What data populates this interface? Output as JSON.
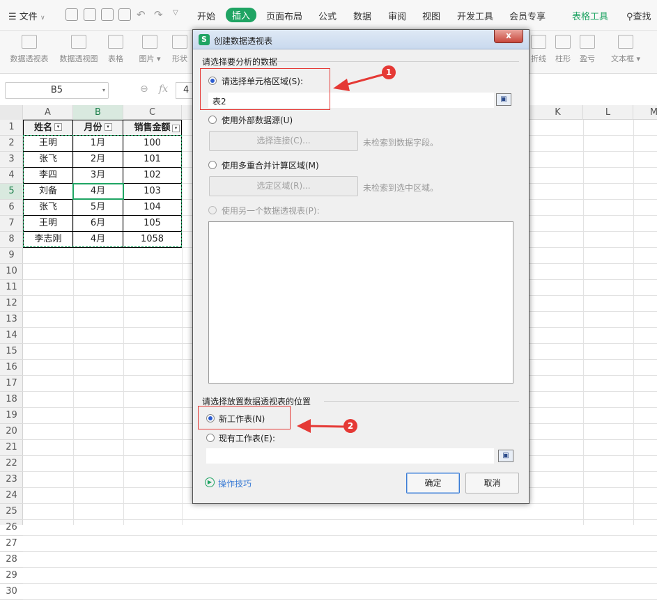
{
  "menubar": {
    "file_label": "文件",
    "tabs": [
      "开始",
      "插入",
      "页面布局",
      "公式",
      "数据",
      "审阅",
      "视图",
      "开发工具",
      "会员专享",
      "表格工具"
    ],
    "active_tab": "插入",
    "search_label": "查找"
  },
  "ribbon": {
    "items": [
      "数据透视表",
      "数据透视图",
      "表格",
      "图片",
      "形状",
      "折线",
      "柱形",
      "盈亏",
      "文本框"
    ]
  },
  "formula": {
    "name_box": "B5",
    "fx_label": "fx",
    "value": "4"
  },
  "sheet": {
    "columns": [
      "A",
      "B",
      "C",
      "K",
      "L",
      "M"
    ],
    "rows": [
      "1",
      "2",
      "3",
      "4",
      "5",
      "6",
      "7",
      "8",
      "9",
      "10",
      "11",
      "12",
      "13",
      "14",
      "15",
      "16",
      "17",
      "18",
      "19",
      "20",
      "21",
      "22",
      "23",
      "24",
      "25",
      "26",
      "27",
      "28",
      "29",
      "30"
    ],
    "headers": [
      "姓名",
      "月份",
      "销售金额"
    ],
    "data": [
      [
        "王明",
        "1月",
        "100"
      ],
      [
        "张飞",
        "2月",
        "101"
      ],
      [
        "李四",
        "3月",
        "102"
      ],
      [
        "刘备",
        "4月",
        "103"
      ],
      [
        "张飞",
        "5月",
        "104"
      ],
      [
        "王明",
        "6月",
        "105"
      ],
      [
        "李志刚",
        "4月",
        "1058"
      ]
    ],
    "selected_cell": "B5"
  },
  "dialog": {
    "title": "创建数据透视表",
    "close": "x",
    "section_source": "请选择要分析的数据",
    "opt_range": "请选择单元格区域(S):",
    "range_value": "表2",
    "opt_external": "使用外部数据源(U)",
    "btn_choose_conn": "选择连接(C)...",
    "msg_no_fields": "未检索到数据字段。",
    "opt_multi": "使用多重合并计算区域(M)",
    "btn_select_range": "选定区域(R)...",
    "msg_no_range": "未检索到选中区域。",
    "opt_another": "使用另一个数据透视表(P):",
    "section_dest": "请选择放置数据透视表的位置",
    "opt_new_sheet": "新工作表(N)",
    "opt_existing": "现有工作表(E):",
    "tips": "操作技巧",
    "ok": "确定",
    "cancel": "取消"
  },
  "annotations": {
    "badge1": "1",
    "badge2": "2"
  },
  "colors": {
    "accent": "#1fa463",
    "annotation_red": "#e53935",
    "radio_blue": "#2a5bd0"
  }
}
